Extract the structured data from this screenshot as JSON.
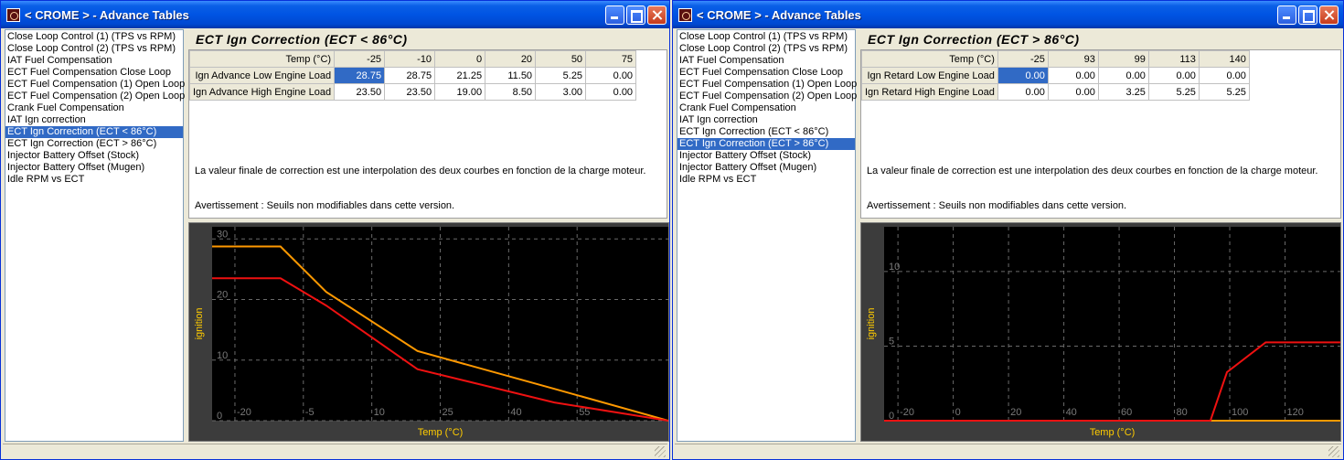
{
  "windows": [
    {
      "title": "< CROME > - Advance Tables",
      "list_items": [
        "Close Loop Control (1) (TPS vs RPM)",
        "Close Loop Control (2) (TPS vs RPM)",
        "IAT Fuel Compensation",
        "ECT Fuel Compensation Close Loop",
        "ECT Fuel Compensation (1) Open Loop",
        "ECT Fuel Compensation (2) Open Loop",
        "Crank Fuel Compensation",
        "IAT Ign correction",
        "ECT Ign Correction (ECT < 86°C)",
        "ECT Ign Correction (ECT > 86°C)",
        "Injector Battery Offset (Stock)",
        "Injector Battery Offset (Mugen)",
        "Idle RPM vs ECT"
      ],
      "selected_index": 8,
      "table_title": "ECT Ign Correction (ECT < 86°C)",
      "table": {
        "header_label": "Temp (°C)",
        "columns": [
          "-25",
          "-10",
          "0",
          "20",
          "50",
          "75"
        ],
        "rows": [
          {
            "label": "Ign Advance Low Engine Load",
            "values": [
              "28.75",
              "28.75",
              "21.25",
              "11.50",
              "5.25",
              "0.00"
            ]
          },
          {
            "label": "Ign Advance High Engine Load",
            "values": [
              "23.50",
              "23.50",
              "19.00",
              "8.50",
              "3.00",
              "0.00"
            ]
          }
        ]
      },
      "note1": "La valeur finale de correction est une interpolation des deux courbes en fonction de la charge moteur.",
      "note2": "Avertissement : Seuils non modifiables dans cette version.",
      "chart_data": {
        "type": "line",
        "xlabel": "Temp (°C)",
        "ylabel": "ignition",
        "xlim": [
          -25,
          75
        ],
        "ylim": [
          0,
          32
        ],
        "x_ticks": [
          "-20",
          "-5",
          "10",
          "25",
          "40",
          "55"
        ],
        "y_ticks": [
          "0",
          "10",
          "20",
          "30"
        ],
        "series": [
          {
            "color": "#FF9900",
            "x": [
              -25,
              -10,
              0,
              20,
              50,
              75
            ],
            "values": [
              28.75,
              28.75,
              21.25,
              11.5,
              5.25,
              0
            ]
          },
          {
            "color": "#EE1111",
            "x": [
              -25,
              -10,
              0,
              20,
              50,
              75
            ],
            "values": [
              23.5,
              23.5,
              19,
              8.5,
              3,
              0
            ]
          }
        ]
      }
    },
    {
      "title": "< CROME > - Advance Tables",
      "list_items": [
        "Close Loop Control (1) (TPS vs RPM)",
        "Close Loop Control (2) (TPS vs RPM)",
        "IAT Fuel Compensation",
        "ECT Fuel Compensation Close Loop",
        "ECT Fuel Compensation (1) Open Loop",
        "ECT Fuel Compensation (2) Open Loop",
        "Crank Fuel Compensation",
        "IAT Ign correction",
        "ECT Ign Correction (ECT < 86°C)",
        "ECT Ign Correction (ECT > 86°C)",
        "Injector Battery Offset (Stock)",
        "Injector Battery Offset (Mugen)",
        "Idle RPM vs ECT"
      ],
      "selected_index": 9,
      "table_title": "ECT Ign Correction (ECT > 86°C)",
      "table": {
        "header_label": "Temp (°C)",
        "columns": [
          "-25",
          "93",
          "99",
          "113",
          "140"
        ],
        "rows": [
          {
            "label": "Ign Retard Low Engine Load",
            "values": [
              "0.00",
              "0.00",
              "0.00",
              "0.00",
              "0.00"
            ]
          },
          {
            "label": "Ign Retard High Engine Load",
            "values": [
              "0.00",
              "0.00",
              "3.25",
              "5.25",
              "5.25"
            ]
          }
        ]
      },
      "note1": "La valeur finale de correction est une interpolation des deux courbes en fonction de la charge moteur.",
      "note2": "Avertissement : Seuils non modifiables dans cette version.",
      "chart_data": {
        "type": "line",
        "xlabel": "Temp (°C)",
        "ylabel": "ignition",
        "xlim": [
          -25,
          140
        ],
        "ylim": [
          0,
          13
        ],
        "x_ticks": [
          "-20",
          "0",
          "20",
          "40",
          "60",
          "80",
          "100",
          "120"
        ],
        "y_ticks": [
          "0",
          "5",
          "10"
        ],
        "series": [
          {
            "color": "#FF9900",
            "x": [
              -25,
              93,
              99,
              113,
              140
            ],
            "values": [
              0,
              0,
              0,
              0,
              0
            ]
          },
          {
            "color": "#EE1111",
            "x": [
              -25,
              93,
              99,
              113,
              140
            ],
            "values": [
              0,
              0,
              3.25,
              5.25,
              5.25
            ]
          }
        ]
      }
    }
  ]
}
